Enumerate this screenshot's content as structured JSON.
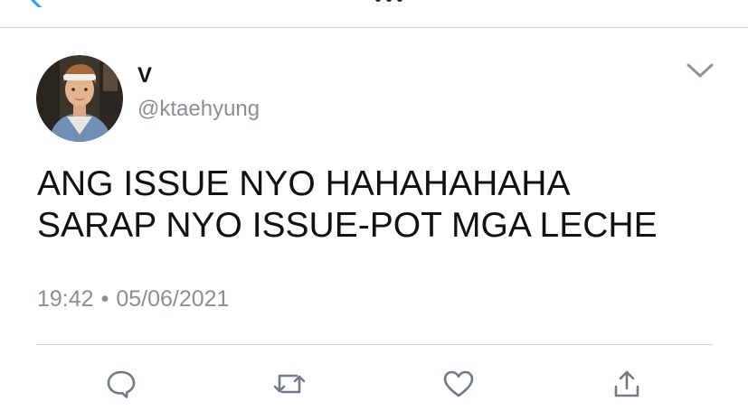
{
  "tweet": {
    "display_name": "V",
    "handle": "@ktaehyung",
    "text_lines": [
      "ANG ISSUE NYO HAHAHAHAHA",
      "SARAP NYO ISSUE-POT MGA LECHE"
    ],
    "time": "19:42",
    "separator": "•",
    "date": "05/06/2021"
  },
  "actions": {
    "reply_icon": "speech-bubble-icon",
    "retweet_icon": "retweet-arrows-icon",
    "like_icon": "heart-icon",
    "share_icon": "share-arrow-up-icon"
  },
  "colors": {
    "accent": "#1da1f2",
    "icon_gray": "#6e7a86",
    "secondary_text": "#8a8f94"
  }
}
